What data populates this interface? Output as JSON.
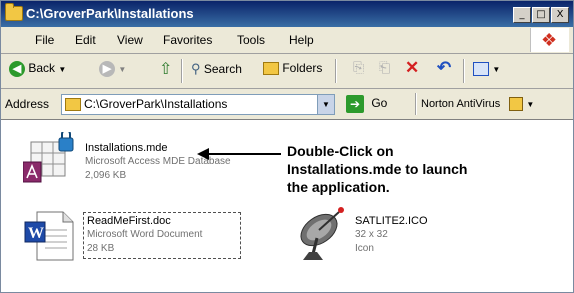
{
  "window": {
    "title": "C:\\GroverPark\\Installations",
    "minimize": "_",
    "maximize": "□",
    "close": "X"
  },
  "menu": [
    "File",
    "Edit",
    "View",
    "Favorites",
    "Tools",
    "Help"
  ],
  "toolbar": {
    "back": "Back",
    "search": "Search",
    "folders": "Folders"
  },
  "address": {
    "label": "Address",
    "value": "C:\\GroverPark\\Installations",
    "go": "Go",
    "norton": "Norton AntiVirus"
  },
  "files": [
    {
      "name": "Installations.mde",
      "type": "Microsoft Access MDE Database",
      "size": "2,096 KB"
    },
    {
      "name": "ReadMeFirst.doc",
      "type": "Microsoft Word Document",
      "size": "28 KB"
    },
    {
      "name": "SATLITE2.ICO",
      "type": "32 x 32",
      "size": "Icon"
    }
  ],
  "annotation": [
    "Double-Click on",
    "Installations.mde to launch",
    "the application."
  ]
}
